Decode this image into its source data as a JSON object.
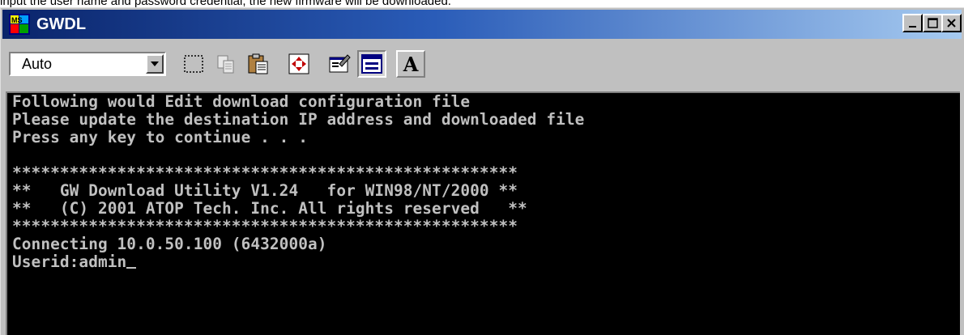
{
  "caption": "input the user name and password credential, the new firmware will be downloaded.",
  "window": {
    "title": "GWDL",
    "icon": "ms-dos-icon",
    "minimize_label": "_",
    "maximize_label": "□",
    "close_label": "×"
  },
  "toolbar": {
    "font_size_value": "Auto",
    "tools": [
      "mark-icon",
      "copy-icon",
      "paste-icon",
      "full-screen-icon",
      "properties-icon",
      "background-icon",
      "font-icon"
    ],
    "font_label": "A"
  },
  "console": {
    "lines": [
      "Following would Edit download configuration file",
      "Please update the destination IP address and downloaded file",
      "Press any key to continue . . .",
      "",
      "*****************************************************",
      "**   GW Download Utility V1.24   for WIN98/NT/2000 **",
      "**   (C) 2001 ATOP Tech. Inc. All rights reserved   **",
      "*****************************************************",
      "Connecting 10.0.50.100 (6432000a)",
      "Userid:admin"
    ]
  },
  "colors": {
    "title_start": "#0a246a",
    "title_end": "#a6caf0",
    "console_bg": "#000000",
    "console_text": "#c0c0c0",
    "chrome": "#c0c0c0"
  }
}
